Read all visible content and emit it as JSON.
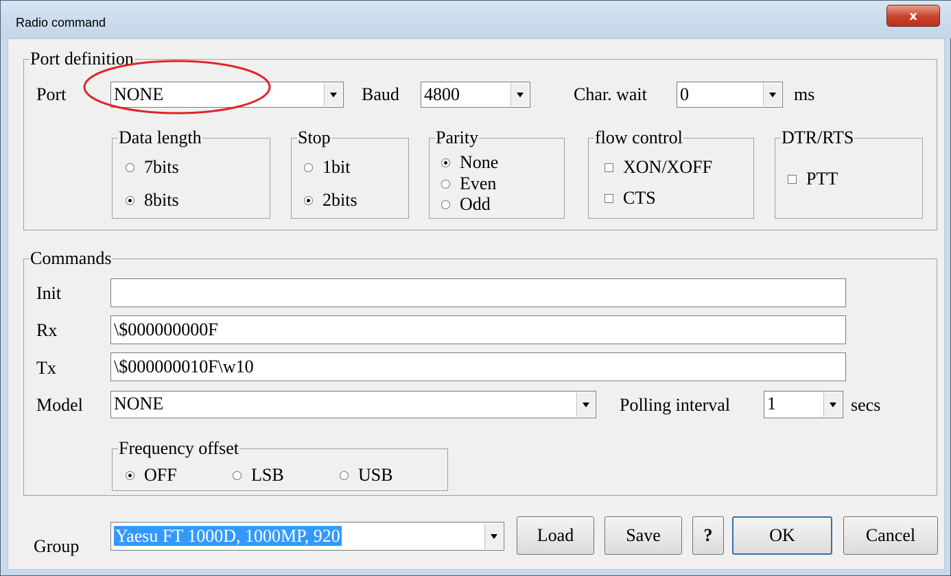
{
  "window": {
    "title": "Radio command",
    "close_glyph": "x"
  },
  "port_definition": {
    "legend": "Port definition",
    "port": {
      "label": "Port",
      "value": "NONE"
    },
    "baud": {
      "label": "Baud",
      "value": "4800"
    },
    "char_wait": {
      "label": "Char. wait",
      "value": "0",
      "unit": "ms"
    },
    "data_length": {
      "legend": "Data length",
      "options": [
        {
          "label": "7bits",
          "selected": false
        },
        {
          "label": "8bits",
          "selected": true
        }
      ]
    },
    "stop": {
      "legend": "Stop",
      "options": [
        {
          "label": "1bit",
          "selected": false
        },
        {
          "label": "2bits",
          "selected": true
        }
      ]
    },
    "parity": {
      "legend": "Parity",
      "options": [
        {
          "label": "None",
          "selected": true
        },
        {
          "label": "Even",
          "selected": false
        },
        {
          "label": "Odd",
          "selected": false
        }
      ]
    },
    "flow_control": {
      "legend": "flow control",
      "options": [
        {
          "label": "XON/XOFF",
          "checked": false
        },
        {
          "label": "CTS",
          "checked": false
        }
      ]
    },
    "dtr_rts": {
      "legend": "DTR/RTS",
      "options": [
        {
          "label": "PTT",
          "checked": false
        }
      ]
    }
  },
  "commands": {
    "legend": "Commands",
    "init": {
      "label": "Init",
      "value": ""
    },
    "rx": {
      "label": "Rx",
      "value": "\\$000000000F"
    },
    "tx": {
      "label": "Tx",
      "value": "\\$000000010F\\w10"
    },
    "model": {
      "label": "Model",
      "value": "NONE"
    },
    "polling": {
      "label": "Polling interval",
      "value": "1",
      "unit": "secs"
    },
    "frequency_offset": {
      "legend": "Frequency offset",
      "options": [
        {
          "label": "OFF",
          "selected": true
        },
        {
          "label": "LSB",
          "selected": false
        },
        {
          "label": "USB",
          "selected": false
        }
      ]
    }
  },
  "bottom": {
    "group_label": "Group",
    "group_value": "Yaesu FT 1000D, 1000MP, 920",
    "buttons": {
      "load": "Load",
      "save": "Save",
      "help": "?",
      "ok": "OK",
      "cancel": "Cancel"
    }
  },
  "colors": {
    "selection": "#3399ff",
    "annotation": "#e0242a",
    "close_button": "#c9412a"
  }
}
